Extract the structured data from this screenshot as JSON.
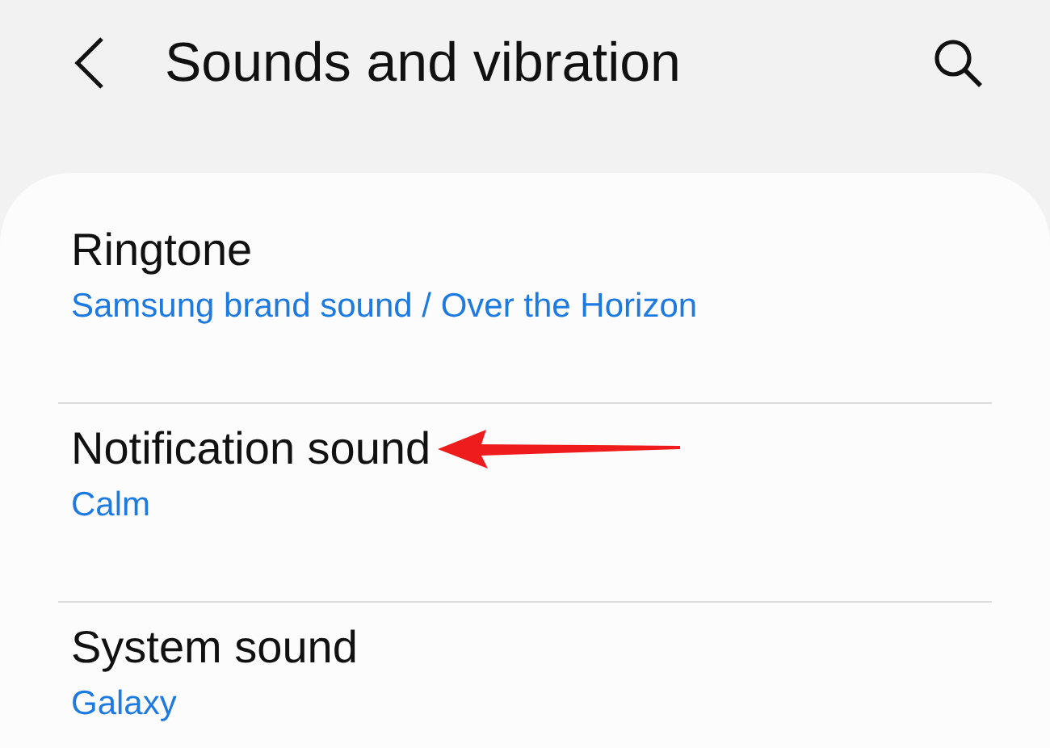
{
  "header": {
    "title": "Sounds and vibration"
  },
  "settings": [
    {
      "title": "Ringtone",
      "value": "Samsung brand sound / Over the Horizon",
      "highlighted": false
    },
    {
      "title": "Notification sound",
      "value": "Calm",
      "highlighted": true
    },
    {
      "title": "System sound",
      "value": "Galaxy",
      "highlighted": false
    }
  ]
}
